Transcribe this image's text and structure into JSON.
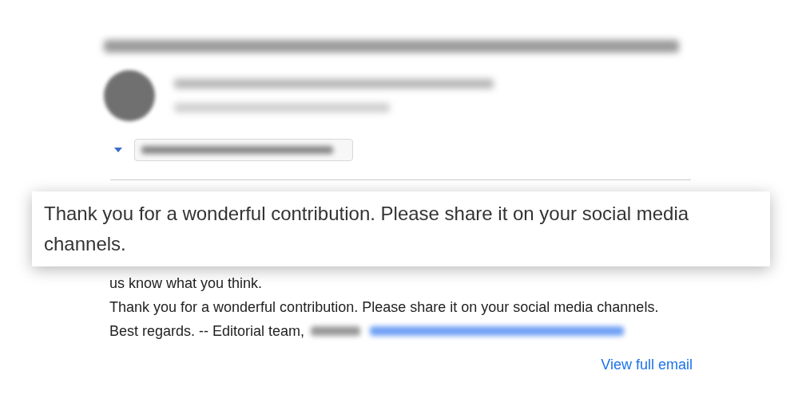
{
  "callout": {
    "text": "Thank you for a wonderful contribution. Please share it on your social media channels."
  },
  "body": {
    "lines": [
      "us know what you think.",
      "Thank you for a wonderful contribution. Please share it on your social media channels."
    ],
    "signature": "Best regards. -- Editorial team,"
  },
  "footer_link": "View full email"
}
